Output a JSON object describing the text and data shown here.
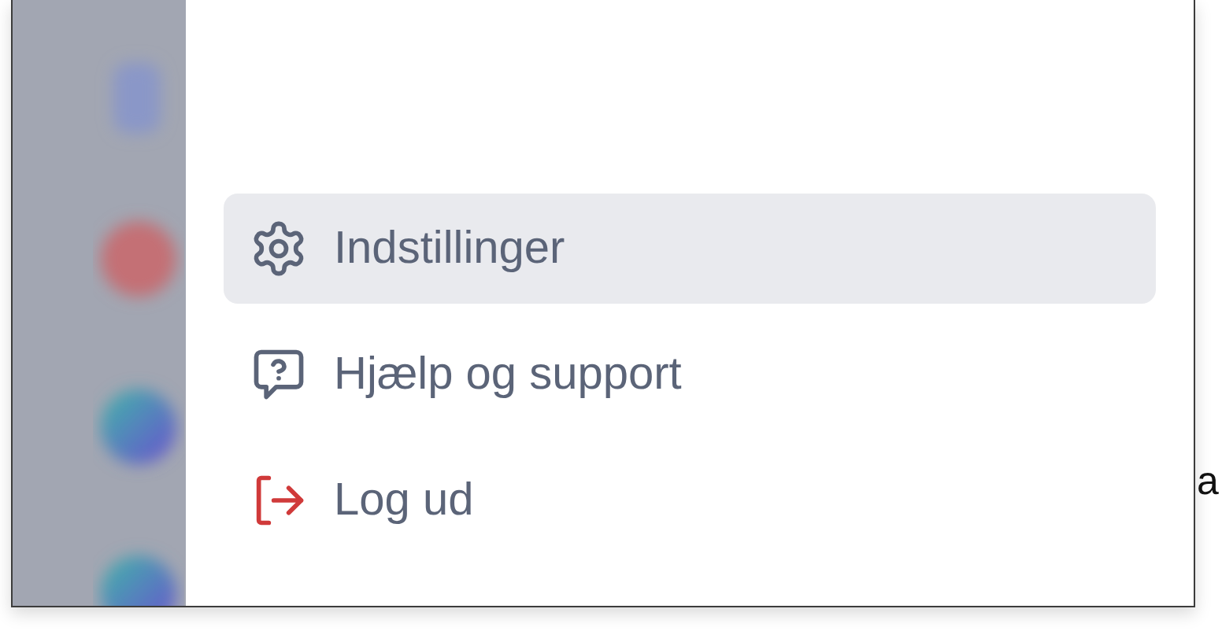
{
  "menu": {
    "items": [
      {
        "kind": "settings",
        "label": "Indstillinger",
        "selected": true
      },
      {
        "kind": "help",
        "label": "Hjælp og support",
        "selected": false
      },
      {
        "kind": "logout",
        "label": "Log ud",
        "selected": false
      }
    ]
  },
  "background_text": "a"
}
